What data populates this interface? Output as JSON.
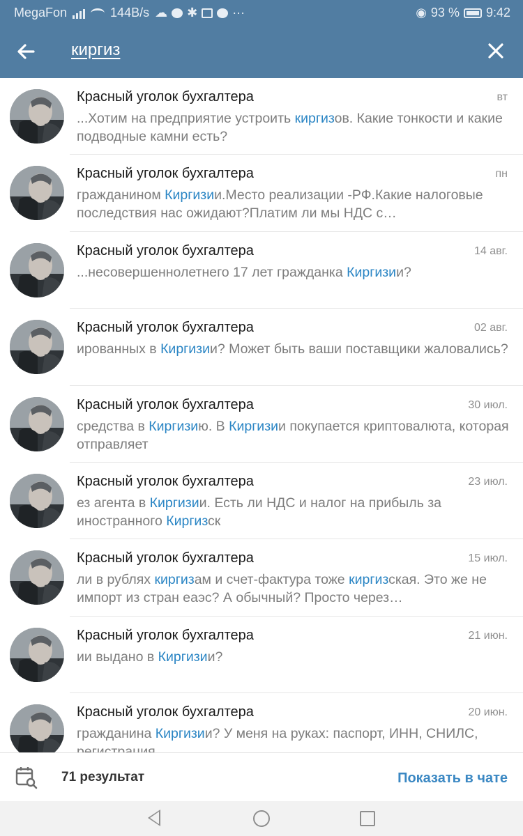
{
  "status": {
    "carrier": "MegaFon",
    "speed": "144B/s",
    "battery": "93 %",
    "time": "9:42"
  },
  "search": {
    "query": "киргиз"
  },
  "results": [
    {
      "title": "Красный уголок бухгалтера",
      "date": "вт",
      "segments": [
        {
          "t": "...Хотим на предприятие устроить "
        },
        {
          "t": "киргиз",
          "hl": true
        },
        {
          "t": "ов. Какие тонкости и какие подводные камни есть?"
        }
      ]
    },
    {
      "title": "Красный уголок бухгалтера",
      "date": "пн",
      "segments": [
        {
          "t": "гражданином "
        },
        {
          "t": "Киргизи",
          "hl": true
        },
        {
          "t": "и.Место реализации -РФ.Какие налоговые последствия нас ожидают?Платим ли мы НДС с…"
        }
      ]
    },
    {
      "title": "Красный уголок бухгалтера",
      "date": "14 авг.",
      "segments": [
        {
          "t": "...несовершеннолетнего 17 лет гражданка "
        },
        {
          "t": "Киргизи",
          "hl": true
        },
        {
          "t": "и?"
        }
      ]
    },
    {
      "title": "Красный уголок бухгалтера",
      "date": "02 авг.",
      "segments": [
        {
          "t": "ированных в "
        },
        {
          "t": "Киргизи",
          "hl": true
        },
        {
          "t": "и? Может быть ваши поставщики жаловались?"
        }
      ]
    },
    {
      "title": "Красный уголок бухгалтера",
      "date": "30 июл.",
      "segments": [
        {
          "t": " средства в "
        },
        {
          "t": "Киргизи",
          "hl": true
        },
        {
          "t": "ю.  В "
        },
        {
          "t": "Киргизи",
          "hl": true
        },
        {
          "t": "и покупается криптовалюта, которая отправляет"
        }
      ]
    },
    {
      "title": "Красный уголок бухгалтера",
      "date": "23 июл.",
      "segments": [
        {
          "t": "ез агента в "
        },
        {
          "t": "Киргизи",
          "hl": true
        },
        {
          "t": "и. Есть ли НДС и налог на прибыль за иностранного "
        },
        {
          "t": "Киргиз",
          "hl": true
        },
        {
          "t": "ск"
        }
      ]
    },
    {
      "title": "Красный уголок бухгалтера",
      "date": "15 июл.",
      "segments": [
        {
          "t": "ли в рублях "
        },
        {
          "t": "киргиз",
          "hl": true
        },
        {
          "t": "ам и счет-фактура тоже "
        },
        {
          "t": "киргиз",
          "hl": true
        },
        {
          "t": "ская. Это же не импорт из стран еаэс? А обычный? Просто через…"
        }
      ]
    },
    {
      "title": "Красный уголок бухгалтера",
      "date": "21 июн.",
      "segments": [
        {
          "t": "ии выдано в "
        },
        {
          "t": "Киргизи",
          "hl": true
        },
        {
          "t": "и?"
        }
      ]
    },
    {
      "title": "Красный уголок бухгалтера",
      "date": "20 июн.",
      "segments": [
        {
          "t": " гражданина "
        },
        {
          "t": "Киргизи",
          "hl": true
        },
        {
          "t": "и? У меня на руках: паспорт, ИНН, СНИЛС, регистрация"
        }
      ]
    }
  ],
  "footer": {
    "count_label": "71 результат",
    "show_in_chat": "Показать в чате"
  },
  "colors": {
    "header": "#517da2",
    "highlight": "#2a85c4",
    "action": "#3b88c3"
  },
  "icons": {
    "back": "arrow-left-icon",
    "close": "close-icon",
    "calendar": "calendar-search-icon"
  }
}
